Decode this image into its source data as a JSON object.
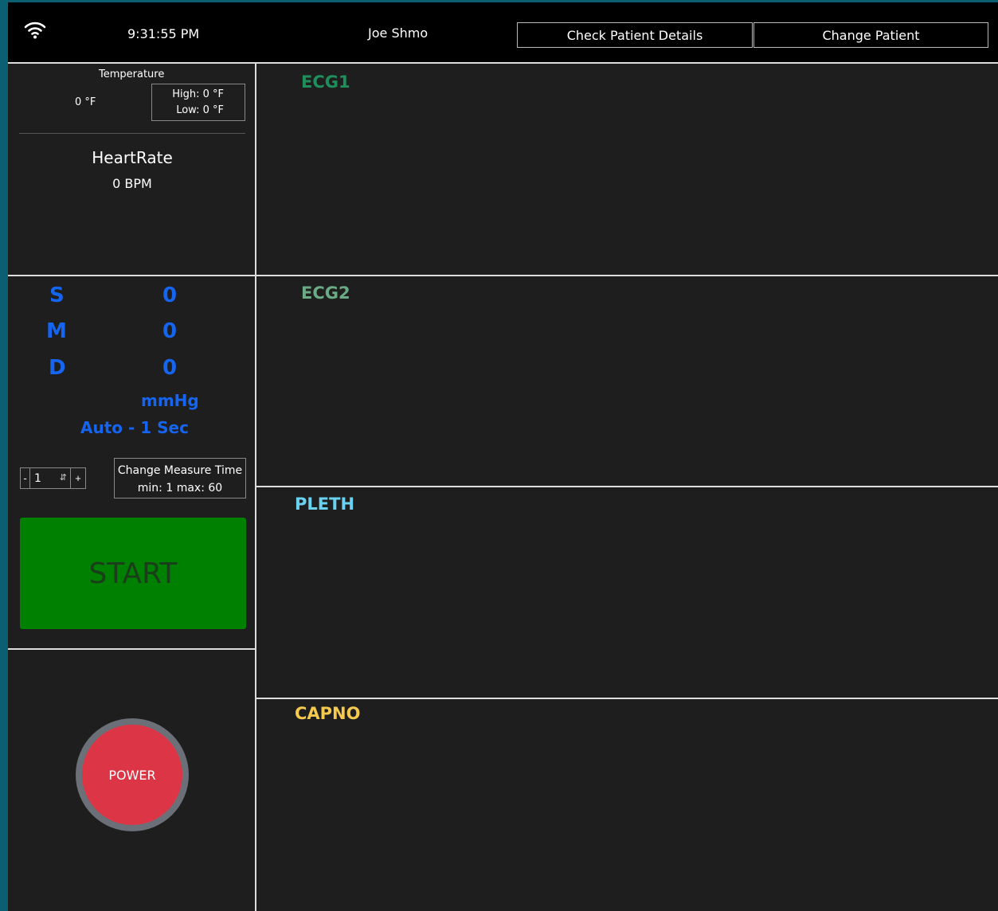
{
  "topbar": {
    "time": "9:31:55 PM",
    "user": "Joe Shmo",
    "check_details_label": "Check Patient Details",
    "change_patient_label": "Change Patient"
  },
  "temperature": {
    "title": "Temperature",
    "value": "0 °F",
    "high": "High: 0 °F",
    "low": "Low: 0 °F"
  },
  "heart_rate": {
    "title": "HeartRate",
    "value": "0 BPM"
  },
  "blood_pressure": {
    "systolic_label": "S",
    "systolic_value": "0",
    "mean_label": "M",
    "mean_value": "0",
    "diastolic_label": "D",
    "diastolic_value": "0",
    "unit": "mmHg",
    "mode": "Auto - 1 Sec",
    "color": "#1565f0"
  },
  "measure_time": {
    "minus_label": "-",
    "value": "1",
    "plus_label": "+",
    "title": "Change Measure Time",
    "range": "min: 1 max: 60"
  },
  "start_label": "START",
  "power_label": "POWER",
  "waveforms": [
    {
      "label": "ECG1",
      "color": "#1e8f5a"
    },
    {
      "label": "ECG2",
      "color": "#6aab86"
    },
    {
      "label": "PLETH",
      "color": "#6ad2f0"
    },
    {
      "label": "CAPNO",
      "color": "#f5c94d"
    }
  ]
}
